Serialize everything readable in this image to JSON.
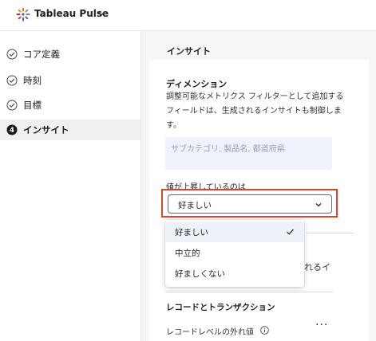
{
  "app": {
    "title": "Tableau Pulse"
  },
  "steps": [
    {
      "label": "コア定義",
      "state": "done"
    },
    {
      "label": "時刻",
      "state": "done"
    },
    {
      "label": "目標",
      "state": "done"
    },
    {
      "label": "インサイト",
      "state": "active",
      "number": "4"
    }
  ],
  "main": {
    "section_title": "インサイト",
    "dimension": {
      "title": "ディメンション",
      "description": "調整可能なメトリクス フィルターとして追加するフィールドは、生成されるインサイトも制御します。",
      "placeholder": "サブカテゴリ, 製品名, 都道府県"
    },
    "trend": {
      "label": "値が上昇しているのは",
      "selected": "好ましい",
      "options": [
        "好ましい",
        "中立的",
        "好ましくない"
      ]
    },
    "occluded_text": "れるイ",
    "records": {
      "title": "レコードとトランザクション",
      "item_label": "レコードレベルの外れ値"
    }
  },
  "colors": {
    "highlight": "#e2412b",
    "accent": "#5e6a83"
  }
}
